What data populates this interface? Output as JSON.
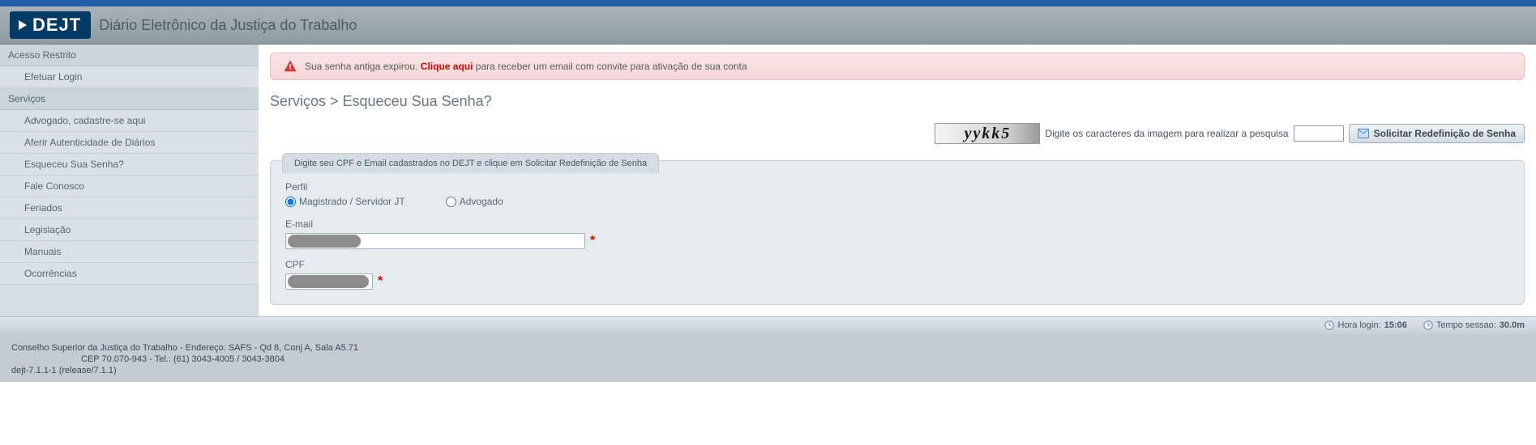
{
  "header": {
    "logo_text": "DEJT",
    "title": "Diário Eletrônico da Justiça do Trabalho"
  },
  "sidebar": {
    "sections": [
      {
        "header": "Acesso Restrito",
        "items": [
          "Efetuar Login"
        ]
      },
      {
        "header": "Serviços",
        "items": [
          "Advogado, cadastre-se aqui",
          "Aferir Autenticidade de Diários",
          "Esqueceu Sua Senha?",
          "Fale Conosco",
          "Feriados",
          "Legislação",
          "Manuais",
          "Ocorrências"
        ]
      }
    ]
  },
  "alert": {
    "prefix": "Sua senha antiga expirou. ",
    "link": "Clique aqui",
    "suffix": " para receber um email com convite para ativação de sua conta"
  },
  "breadcrumb": "Serviços > Esqueceu Sua Senha?",
  "captcha": {
    "image_text": "yykk5",
    "label": "Digite os caracteres da imagem para realizar a pesquisa",
    "button": "Solicitar Redefinição de Senha"
  },
  "form": {
    "legend": "Digite seu CPF e Email cadastrados no DEJT e clique em Solicitar Redefinição de Senha",
    "perfil_label": "Perfil",
    "perfil_options": {
      "magistrado": "Magistrado / Servidor JT",
      "advogado": "Advogado"
    },
    "email_label": "E-mail",
    "cpf_label": "CPF",
    "required_mark": "*"
  },
  "status": {
    "login_label": "Hora login:",
    "login_value": "15:06",
    "session_label": "Tempo sessao:",
    "session_value": "30.0m"
  },
  "footer": {
    "line1": "Conselho Superior da Justiça do Trabalho - Endereço: SAFS - Qd 8, Conj A, Sala A5.71",
    "line2": "CEP 70.070-943 - Tel.: (61) 3043-4005 / 3043-3804",
    "line3": "dejt-7.1.1-1 (release/7.1.1)"
  }
}
